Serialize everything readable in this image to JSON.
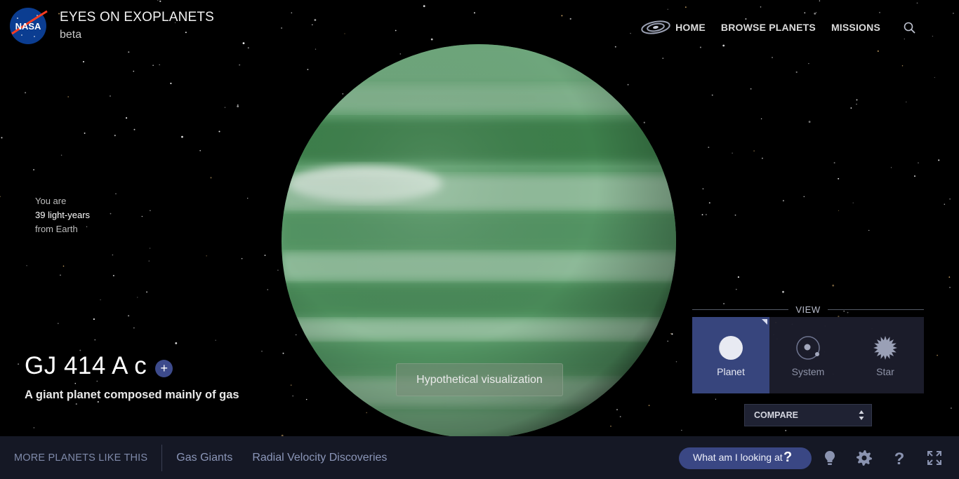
{
  "header": {
    "title": "EYES ON EXOPLANETS",
    "subtitle": "beta",
    "logo_text": "NASA",
    "nav": [
      {
        "label": "HOME",
        "icon": "galaxy-icon"
      },
      {
        "label": "BROWSE PLANETS"
      },
      {
        "label": "MISSIONS"
      }
    ],
    "search_icon": "search-icon"
  },
  "distance": {
    "line1": "You are",
    "line2": "39 light-years",
    "line3": "from Earth"
  },
  "planet": {
    "name": "GJ 414 A c",
    "add_label": "+",
    "description": "A giant planet composed mainly of gas",
    "visualization_note": "Hypothetical visualization",
    "colors": {
      "base": "#5f9f6e",
      "band": "#3e7f4c",
      "cloud": "#d9e6dc"
    }
  },
  "view": {
    "label": "VIEW",
    "options": [
      {
        "label": "Planet",
        "icon": "planet-icon",
        "active": true
      },
      {
        "label": "System",
        "icon": "system-icon",
        "active": false
      },
      {
        "label": "Star",
        "icon": "star-icon",
        "active": false
      }
    ],
    "compare_label": "COMPARE"
  },
  "bottom": {
    "more_label": "MORE PLANETS LIKE THIS",
    "tags": [
      "Gas Giants",
      "Radial Velocity Discoveries"
    ],
    "what_label": "What am I looking at",
    "what_q": "?",
    "icons": [
      "lightbulb-icon",
      "gear-icon",
      "help-icon",
      "fullscreen-icon"
    ]
  },
  "colors": {
    "accent": "#3a4784",
    "panel": "#151825",
    "active_view": "#37457d"
  }
}
